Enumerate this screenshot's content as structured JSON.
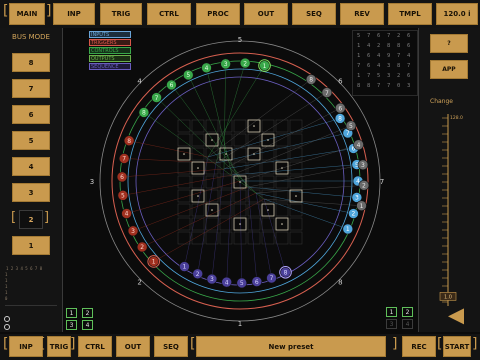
{
  "topbar": {
    "main": "MAIN",
    "inp": "INP",
    "trig": "TRIG",
    "ctrl": "CTRL",
    "proc": "PROC",
    "out": "OUT",
    "seq": "SEQ",
    "rev": "REV",
    "tmpl": "TMPL",
    "tempo": "120.0 i"
  },
  "sidebar": {
    "title": "BUS MODE",
    "buttons": [
      "8",
      "7",
      "6",
      "5",
      "4",
      "3",
      "2",
      "1"
    ],
    "selected": "2",
    "mini_numbers": "1 2 3 4 5 6 7 8",
    "mini_column": "1 1 1 1 0",
    "pad_top": [
      "1",
      "2"
    ],
    "pad_bottom": [
      "3",
      "4"
    ]
  },
  "legend": {
    "items": [
      {
        "label": "INPUTS",
        "color": "#6aa5d8"
      },
      {
        "label": "TRIGGERS",
        "color": "#d8574a"
      },
      {
        "label": "CONTROLS",
        "color": "#39a84a"
      },
      {
        "label": "OUTPUTS",
        "color": "#6ab04c"
      },
      {
        "label": "SEQUENCE",
        "color": "#6a5ec0"
      }
    ]
  },
  "ring": {
    "outer_labels": [
      "5",
      "6",
      "7",
      "8",
      "1",
      "2",
      "3",
      "4"
    ],
    "nodes_green": [
      "1",
      "2",
      "3",
      "4",
      "5",
      "6",
      "7",
      "8"
    ],
    "nodes_blue": [
      "8",
      "7",
      "6",
      "5",
      "4",
      "3",
      "2",
      "1"
    ],
    "nodes_purple": [
      "1",
      "2",
      "3",
      "4",
      "5",
      "6",
      "7",
      "8"
    ],
    "nodes_red": [
      "8",
      "7",
      "6",
      "5",
      "4",
      "3",
      "2",
      "1"
    ],
    "nodes_gray": [
      "8",
      "7",
      "6",
      "5",
      "4",
      "3",
      "2",
      "1"
    ]
  },
  "numgrid": {
    "rows": [
      [
        "5",
        "7",
        "6",
        "7",
        "2",
        "6"
      ],
      [
        "1",
        "4",
        "2",
        "8",
        "8",
        "6"
      ],
      [
        "1",
        "6",
        "4",
        "9",
        "7",
        "4"
      ],
      [
        "7",
        "6",
        "4",
        "3",
        "8",
        "7"
      ],
      [
        "1",
        "7",
        "5",
        "3",
        "2",
        "6"
      ],
      [
        "8",
        "8",
        "7",
        "7",
        "0",
        "3"
      ]
    ]
  },
  "right_panel": {
    "question": "?",
    "app": "APP",
    "change_label": "Change",
    "slider_top": "128.0",
    "slider_value": "1.0",
    "slider_level": 0.05,
    "pad_top": [
      "1",
      "2"
    ],
    "pad_bottom": [
      "3",
      "4"
    ]
  },
  "bottombar": {
    "inp": "INP",
    "trig": "TRIG",
    "ctrl": "CTRL",
    "out": "OUT",
    "seq": "SEQ",
    "preset": "New preset",
    "rec": "REC",
    "start": "START"
  },
  "colors": {
    "accent": "#c99a4e",
    "green": "#39a84a",
    "blue": "#4fa6dc",
    "purple": "#6a5ec0",
    "red": "#b83a2e",
    "gray": "#8a8a8a"
  }
}
